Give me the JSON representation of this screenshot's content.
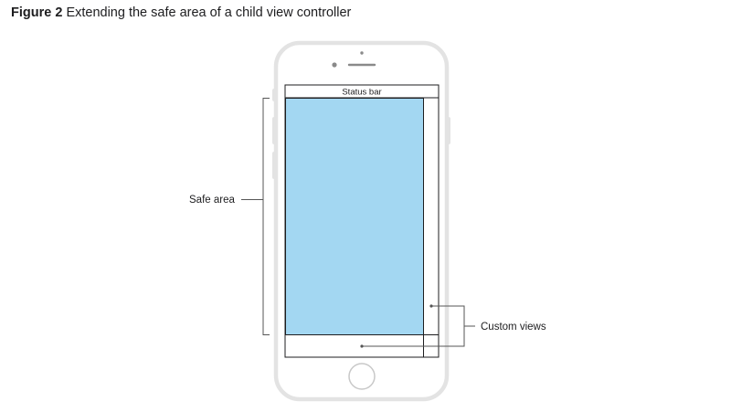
{
  "caption": {
    "figure_label": "Figure 2",
    "text": "Extending the safe area of a child view controller"
  },
  "diagram": {
    "status_bar_label": "Status bar",
    "safe_area_label": "Safe area",
    "custom_views_label": "Custom views",
    "colors": {
      "safe_area_fill": "#a3d7f2",
      "device_outline": "#e3e3e3",
      "line": "#1d1d1f",
      "callout": "#555555"
    }
  }
}
